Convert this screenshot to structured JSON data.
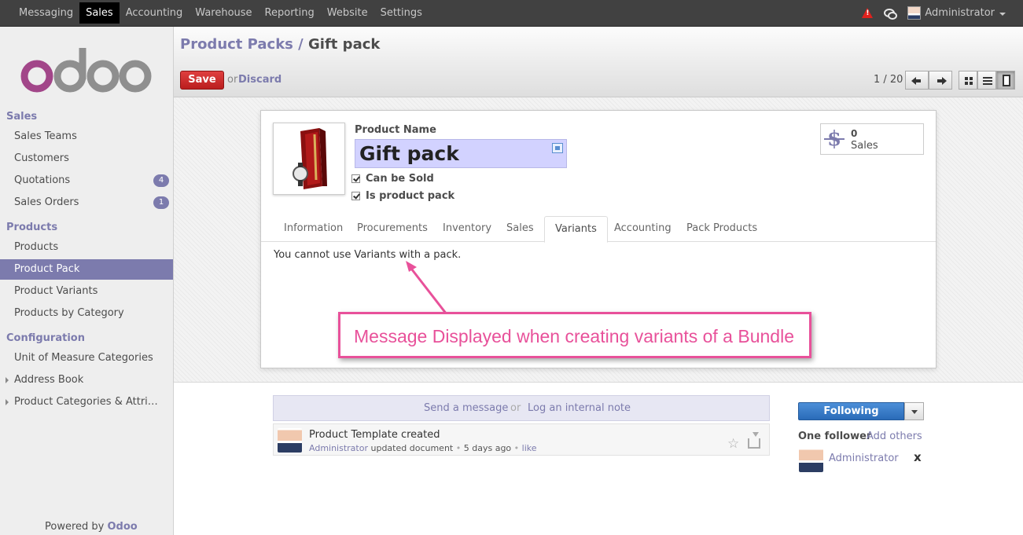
{
  "topbar": {
    "menu": [
      "Messaging",
      "Sales",
      "Accounting",
      "Warehouse",
      "Reporting",
      "Website",
      "Settings"
    ],
    "active_menu": "Sales",
    "user": "Administrator",
    "warning_symbol": "!"
  },
  "sidebar": {
    "logo_text": "odoo",
    "sections": [
      {
        "title": "Sales",
        "items": [
          {
            "label": "Sales Teams"
          },
          {
            "label": "Customers"
          },
          {
            "label": "Quotations",
            "badge": "4"
          },
          {
            "label": "Sales Orders",
            "badge": "1"
          }
        ]
      },
      {
        "title": "Products",
        "items": [
          {
            "label": "Products"
          },
          {
            "label": "Product Pack",
            "active": true
          },
          {
            "label": "Product Variants"
          },
          {
            "label": "Products by Category"
          }
        ]
      },
      {
        "title": "Configuration",
        "items": [
          {
            "label": "Unit of Measure Categories"
          },
          {
            "label": "Address Book"
          },
          {
            "label": "Product Categories & Attri…"
          }
        ]
      }
    ],
    "powered_by": "Powered by",
    "powered_brand": "Odoo"
  },
  "header": {
    "breadcrumb_parent": "Product Packs",
    "breadcrumb_sep": "/",
    "breadcrumb_current": "Gift pack",
    "save_label": "Save",
    "or_text": "or",
    "discard_label": "Discard",
    "pager": "1 / 20"
  },
  "form": {
    "product_name_label": "Product Name",
    "product_name": "Gift pack",
    "can_be_sold": "Can be Sold",
    "is_product_pack": "Is product pack",
    "sales_count": "0",
    "sales_label": "Sales",
    "tabs": [
      "Information",
      "Procurements",
      "Inventory",
      "Sales",
      "Variants",
      "Accounting",
      "Pack Products"
    ],
    "active_tab": "Variants",
    "variants_message": "You cannot use Variants with a pack."
  },
  "annotation": {
    "text": "Message Displayed when creating variants of a Bundle",
    "color": "#e8519a"
  },
  "chatter": {
    "send_message": "Send a message",
    "or_text": "or",
    "log_note": "Log an internal note",
    "message_title": "Product Template created",
    "message_author": "Administrator",
    "message_action": "updated document",
    "message_time": "5 days ago",
    "message_like": "like",
    "following_label": "Following",
    "follower_count": "One follower",
    "add_others": "Add others",
    "follower_name": "Administrator",
    "remove_symbol": "x"
  },
  "colors": {
    "accent": "#7c7bad",
    "topbar": "#414141",
    "save": "#d43030",
    "name_field": "#d2d2ff",
    "following": "#3a7cc8"
  }
}
